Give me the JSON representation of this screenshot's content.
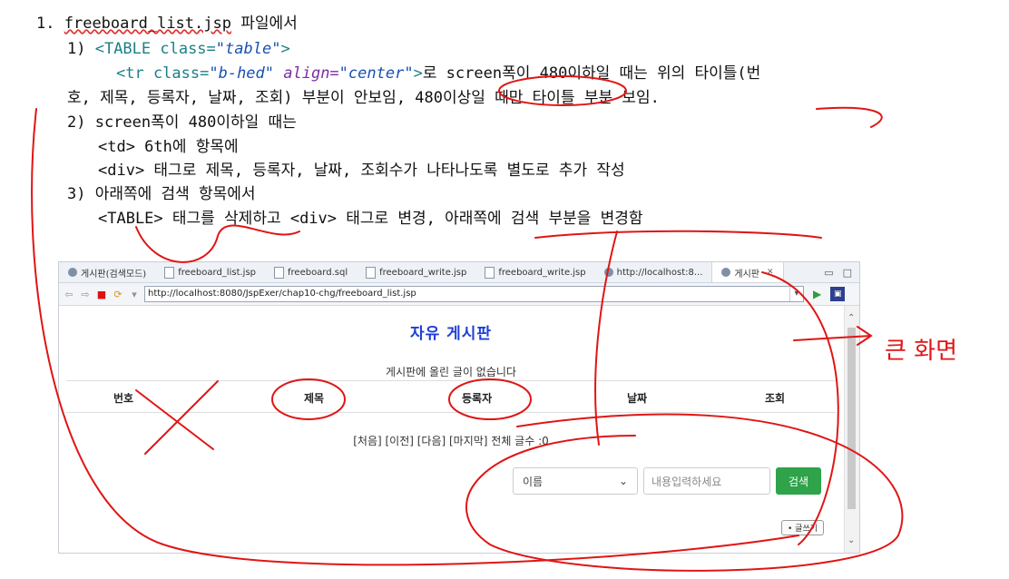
{
  "notes": {
    "line1_num": "1.",
    "line1_file": "freeboard_list.jsp",
    "line1_rest": " 파일에서",
    "l2_prefix": "1) ",
    "l2_tag": "<TABLE class=",
    "l2_val": "\"table\"",
    "l2_end": ">",
    "l3_tag": "<tr class=",
    "l3_val1": "\"b-hed\"",
    "l3_attr": " align=",
    "l3_val2": "\"center\"",
    "l3_end": ">",
    "l3_text": "로 screen폭이 480이하일 때는 위의 타이틀(번",
    "l4_text": "호, 제목, 등록자, 날짜, 조회) 부분이 안보임, 480이상일 때만 타이틀 부분 보임.",
    "l5_text": "2) screen폭이 480이하일 때는",
    "l6_text": "<td> 6th에 항목에",
    "l7_text": "<div> 태그로 제목, 등록자, 날짜, 조회수가 나타나도록 별도로 추가 작성",
    "l8_text": "3) 아래쪽에 검색 항목에서",
    "l9_text": "<TABLE> 태그를 삭제하고 <div> 태그로 변경, 아래쪽에 검색 부분을 변경함"
  },
  "handwriting": "큰 화면",
  "browser": {
    "tabs": [
      {
        "label": "게시판(검색모드)",
        "icon": "globe-icon"
      },
      {
        "label": "freeboard_list.jsp",
        "icon": "file-icon"
      },
      {
        "label": "freeboard.sql",
        "icon": "sql-file-icon"
      },
      {
        "label": "freeboard_write.jsp",
        "icon": "file-icon"
      },
      {
        "label": "freeboard_write.jsp",
        "icon": "file-icon"
      },
      {
        "label": "http://localhost:8...",
        "icon": "globe-icon"
      },
      {
        "label": "게시판",
        "icon": "globe-icon"
      }
    ],
    "url": "http://localhost:8080/JspExer/chap10-chg/freeboard_list.jsp"
  },
  "page": {
    "title": "자유 게시판",
    "empty_message": "게시판에 올린 글이 없습니다",
    "columns": [
      "번호",
      "제목",
      "등록자",
      "날짜",
      "조회"
    ],
    "pager": "[처음] [이전] [다음] [마지막] 전체 글수 :0",
    "search_select": "이름",
    "search_placeholder": "내용입력하세요",
    "search_button": "검색",
    "write_button": "• 글쓰기"
  },
  "colors": {
    "title": "#1d3fd6",
    "search_button": "#2fa34a",
    "ink": "#e01515"
  }
}
